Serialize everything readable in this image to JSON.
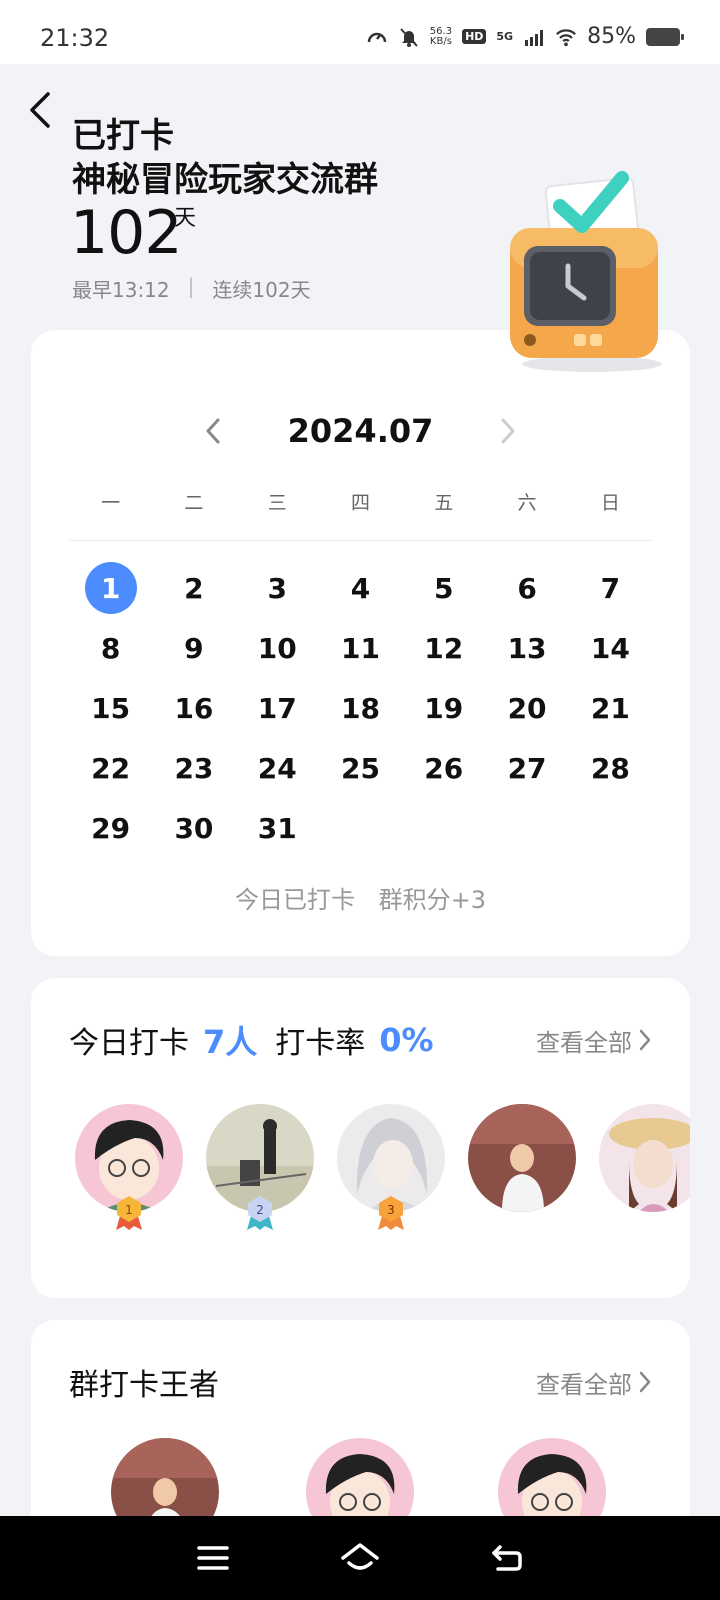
{
  "status_bar": {
    "time": "21:32",
    "net_speed_value": "56.3",
    "net_speed_unit": "KB/s",
    "hd_label": "HD",
    "network_label": "5G",
    "battery": "85%"
  },
  "header": {
    "title_status": "已打卡",
    "group_name": "神秘冒险玩家交流群",
    "days_count": "102",
    "days_unit": "天",
    "earliest": "最早13:12",
    "separator": "|",
    "streak": "连续102天"
  },
  "calendar": {
    "month": "2024.07",
    "weekdays": [
      "一",
      "二",
      "三",
      "四",
      "五",
      "六",
      "日"
    ],
    "days": [
      "1",
      "2",
      "3",
      "4",
      "5",
      "6",
      "7",
      "8",
      "9",
      "10",
      "11",
      "12",
      "13",
      "14",
      "15",
      "16",
      "17",
      "18",
      "19",
      "20",
      "21",
      "22",
      "23",
      "24",
      "25",
      "26",
      "27",
      "28",
      "29",
      "30",
      "31"
    ],
    "selected_day": "1",
    "status_text": "今日已打卡",
    "points_text": "群积分+3"
  },
  "today_checkin": {
    "label": "今日打卡",
    "count": "7人",
    "rate_label": "打卡率",
    "rate_value": "0%",
    "view_all": "查看全部",
    "medals": [
      "1",
      "2",
      "3"
    ]
  },
  "king": {
    "label": "群打卡王者",
    "view_all": "查看全部"
  },
  "colors": {
    "accent": "#4c8cff",
    "background": "#f2f3f7",
    "card": "#ffffff"
  }
}
